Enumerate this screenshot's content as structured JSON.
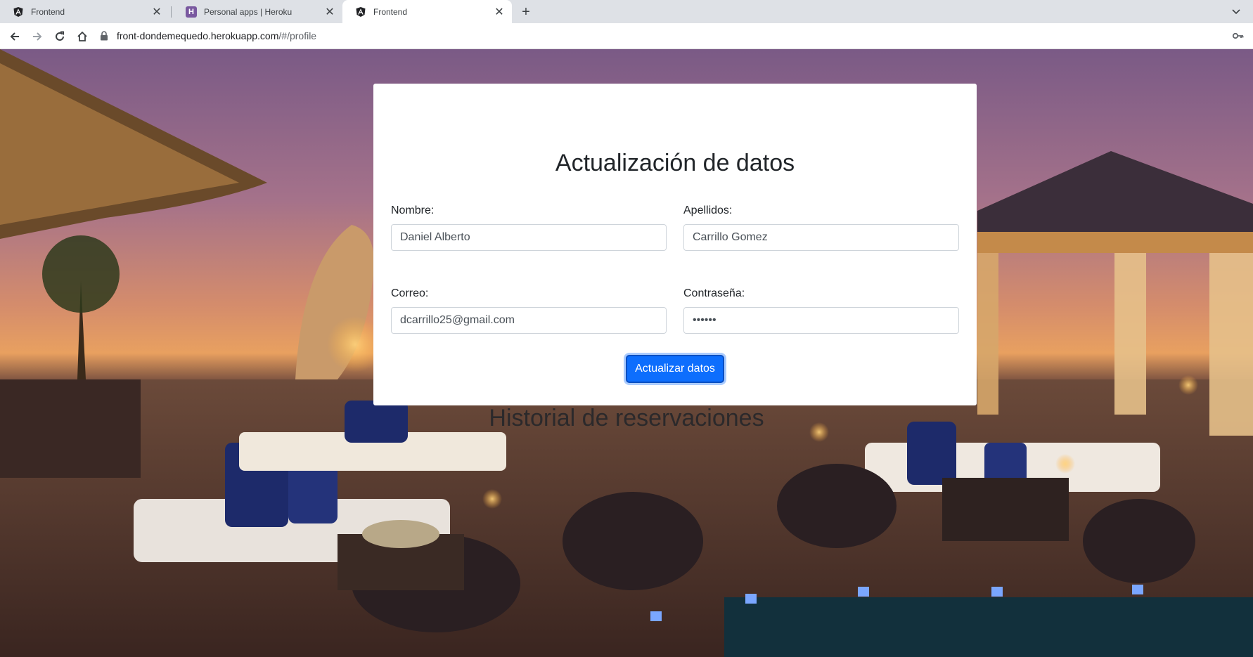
{
  "browser": {
    "tabs": [
      {
        "title": "Frontend",
        "icon": "angular-icon",
        "active": false
      },
      {
        "title": "Personal apps | Heroku",
        "icon": "heroku-icon",
        "active": false
      },
      {
        "title": "Frontend",
        "icon": "angular-icon",
        "active": true
      }
    ],
    "new_tab_symbol": "+",
    "close_symbol": "✕",
    "url_host": "front-dondemequedo.herokuapp.com",
    "url_path": "/#/profile"
  },
  "form": {
    "title": "Actualización de datos",
    "fields": {
      "nombre": {
        "label": "Nombre:",
        "value": "Daniel Alberto"
      },
      "apellidos": {
        "label": "Apellidos:",
        "value": "Carrillo Gomez"
      },
      "correo": {
        "label": "Correo:",
        "value": "dcarrillo25@gmail.com"
      },
      "contrasena": {
        "label": "Contraseña:",
        "value": "••••••"
      }
    },
    "submit_label": "Actualizar datos"
  },
  "history": {
    "heading": "Historial de reservaciones"
  },
  "colors": {
    "primary": "#0d6efd",
    "chrome_bg": "#dee1e6"
  }
}
